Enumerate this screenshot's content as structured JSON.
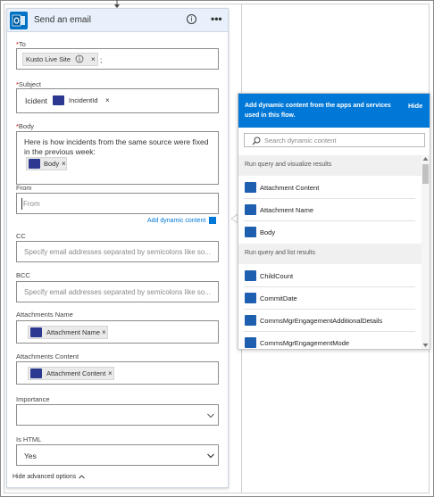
{
  "card": {
    "title": "Send an email",
    "to": {
      "label": "To",
      "chip": "Kusto Live Site",
      "suffix": ";"
    },
    "subject": {
      "label": "Subject",
      "prefix": "Icident",
      "chip": "IncidentId"
    },
    "body": {
      "label": "Body",
      "text": "Here is how incidents from the same source were fixed in the previous week:",
      "chip": "Body"
    },
    "from": {
      "label": "From",
      "placeholder": "From",
      "add_dynamic": "Add dynamic content"
    },
    "cc": {
      "label": "CC",
      "placeholder": "Specify email addresses separated by semicolons like so..."
    },
    "bcc": {
      "label": "BCC",
      "placeholder": "Specify email addresses separated by semicolons like so..."
    },
    "attachments_name": {
      "label": "Attachments Name",
      "chip": "Attachment Name"
    },
    "attachments_content": {
      "label": "Attachments Content",
      "chip": "Attachment Content"
    },
    "importance": {
      "label": "Importance",
      "value": ""
    },
    "is_html": {
      "label": "Is HTML",
      "value": "Yes"
    },
    "hide_advanced": "Hide advanced options"
  },
  "dynamic": {
    "header": "Add dynamic content from the apps and services used in this flow.",
    "hide": "Hide",
    "search_placeholder": "Search dynamic content",
    "sections": [
      {
        "title": "Run query and visualize results",
        "items": [
          "Attachment Content",
          "Attachment Name",
          "Body"
        ]
      },
      {
        "title": "Run query and list results",
        "items": [
          "ChildCount",
          "CommitDate",
          "CommsMgrEngagementAdditionalDetails",
          "CommsMgrEngagementMode"
        ]
      }
    ]
  },
  "colors": {
    "accent": "#0078d7",
    "header_bg": "#e8f1fb",
    "required": "#cc0000",
    "kusto_icon": "#2b3990"
  },
  "icons": {
    "card": "outlook-icon",
    "info": "info-icon",
    "more": "more-options-icon",
    "search": "search-icon",
    "kusto": "kusto-icon"
  }
}
